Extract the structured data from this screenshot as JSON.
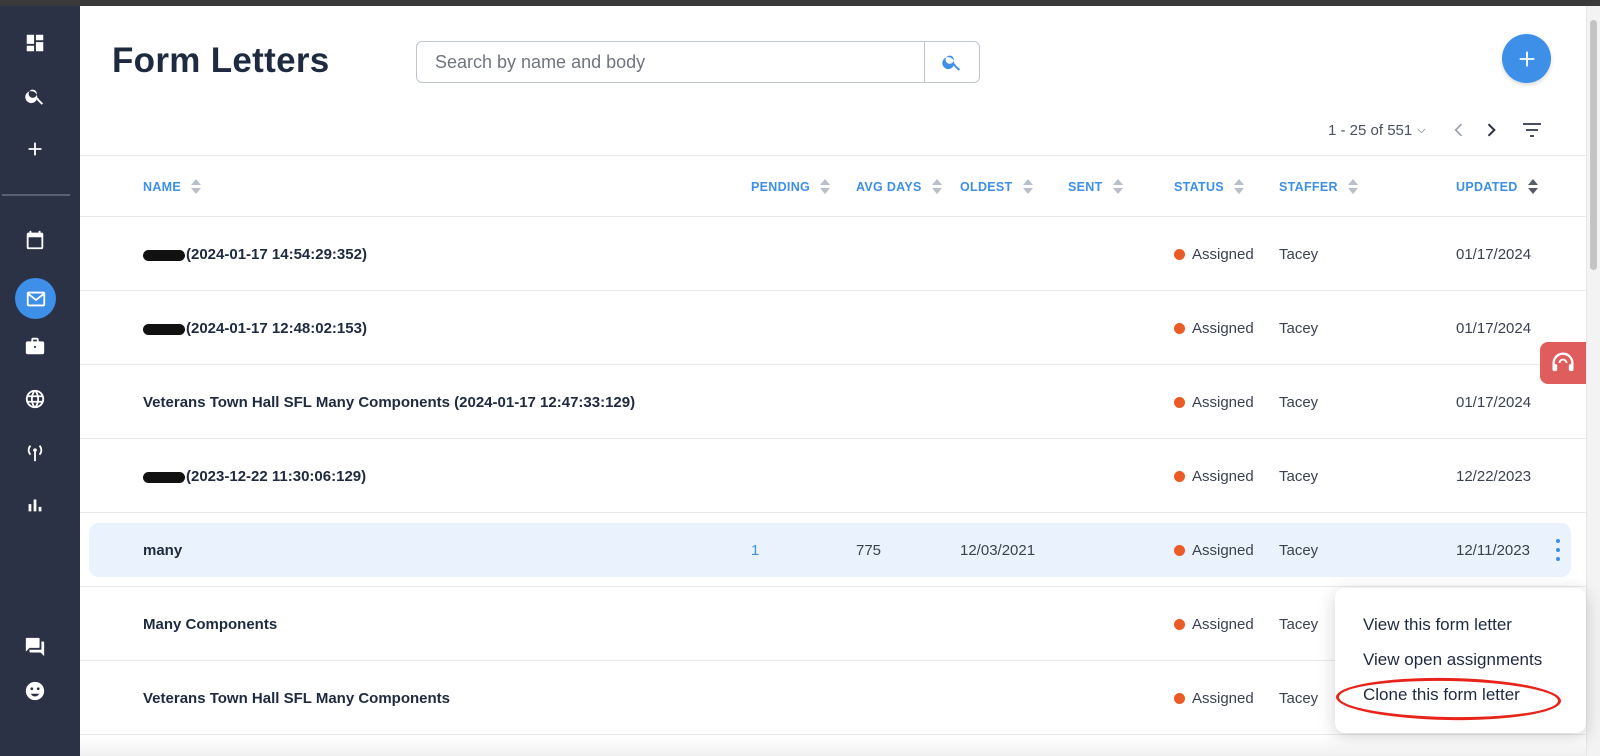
{
  "page": {
    "title": "Form Letters"
  },
  "search": {
    "placeholder": "Search by name and body"
  },
  "pager": {
    "range": "1 - 25 of 551"
  },
  "columns": {
    "name": "NAME",
    "pending": "PENDING",
    "avg_days": "AVG DAYS",
    "oldest": "OLDEST",
    "sent": "SENT",
    "status": "STATUS",
    "staffer": "STAFFER",
    "updated": "UPDATED"
  },
  "rows": [
    {
      "name": "(2024-01-17 14:54:29:352)",
      "pending": "",
      "avg_days": "",
      "oldest": "",
      "status": "Assigned",
      "staffer": "Tacey",
      "updated": "01/17/2024"
    },
    {
      "name": "(2024-01-17 12:48:02:153)",
      "pending": "",
      "avg_days": "",
      "oldest": "",
      "status": "Assigned",
      "staffer": "Tacey",
      "updated": "01/17/2024"
    },
    {
      "name": "Veterans Town Hall SFL Many Components (2024-01-17 12:47:33:129)",
      "pending": "",
      "avg_days": "",
      "oldest": "",
      "status": "Assigned",
      "staffer": "Tacey",
      "updated": "01/17/2024"
    },
    {
      "name": "(2023-12-22 11:30:06:129)",
      "pending": "",
      "avg_days": "",
      "oldest": "",
      "status": "Assigned",
      "staffer": "Tacey",
      "updated": "12/22/2023"
    },
    {
      "name": "many",
      "pending": "1",
      "avg_days": "775",
      "oldest": "12/03/2021",
      "status": "Assigned",
      "staffer": "Tacey",
      "updated": "12/11/2023"
    },
    {
      "name": "Many Components",
      "pending": "",
      "avg_days": "",
      "oldest": "",
      "status": "Assigned",
      "staffer": "Tacey",
      "updated": ""
    },
    {
      "name": "Veterans Town Hall SFL Many Components",
      "pending": "",
      "avg_days": "",
      "oldest": "",
      "status": "Assigned",
      "staffer": "Tacey",
      "updated": ""
    }
  ],
  "context_menu": {
    "items": [
      "View this form letter",
      "View open assignments",
      "Clone this form letter"
    ]
  },
  "colors": {
    "sidebar": "#2b3246",
    "accent": "#3d8fe8",
    "status_assigned": "#ea5b25",
    "highlight_row": "#eaf3fd",
    "annotation": "#e8231a"
  },
  "icons": {
    "sidebar": [
      "dashboard-icon",
      "search-icon",
      "plus-icon",
      "calendar-icon",
      "mail-icon",
      "briefcase-icon",
      "globe-icon",
      "broadcast-icon",
      "bar-chart-icon",
      "chat-icon",
      "face-icon"
    ]
  }
}
